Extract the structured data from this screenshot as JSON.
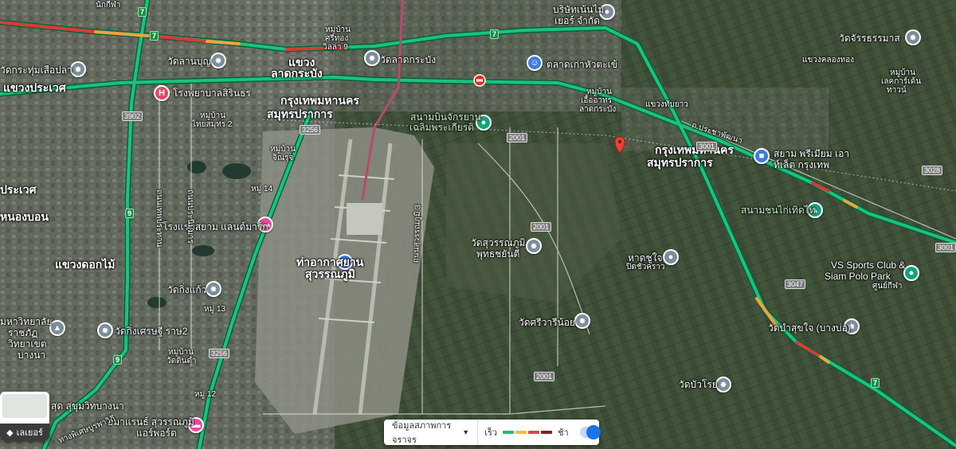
{
  "legend": {
    "traffic_label": "ข้อมูลสภาพการจราจร",
    "fast_label": "เร็ว",
    "slow_label": "ช้า",
    "scale_colors": [
      "#19c37d",
      "#f2c12e",
      "#e3463b",
      "#8c1d1d"
    ],
    "toggle_on": true
  },
  "layers_button": {
    "label": "เลเยอร์"
  },
  "colors": {
    "traffic_green": "#19c37d",
    "traffic_orange": "#f2a23a",
    "traffic_red": "#d83b32",
    "pin_red": "#ea4335"
  },
  "places": {
    "p1": "บริษัทเน้นไม",
    "p1b": "เยอร์ จำกัด",
    "p2": "วัดจัรรธรรมาส",
    "p3": "วัดลานบุญ",
    "p4": "แขวง",
    "p4b": "ลาดกระบัง",
    "p5": "วัดลาดกระบัง",
    "p6": "ตลาดเก่าหัวตะเข้",
    "p7": "วัดกระทุ่มเสือปลา",
    "p8": "แขวงประเวศ",
    "p9": "โรงพยาบาลสิรินธร",
    "p10": "กรุงเทพมหานคร",
    "p10b": "สมุทรปราการ",
    "p11": "สนามบินจักรยาน",
    "p11b": "เฉลิมพระเกียรติ",
    "p12": "กรุงเทพมหานคร",
    "p12b": "สมุทรปราการ",
    "p13": "สยาม พรีเมียม เอา",
    "p13b": "ท์เล็ต กรุงเทพ",
    "p14": "สนามชนไก่เทิดไท",
    "p15": "ประเวศ",
    "p16": "หนองบอน",
    "p17": "โรงแรมสยาม แลนด์มาร์ก",
    "p18": "ท่าอากาศยาน",
    "p18b": "สุวรรณภูมิ",
    "p19": "วัดสุวรรณภูมิ",
    "p19b": "พุทธชยันตี",
    "p20": "หาดชูใจ",
    "p20b": "ปิดชั่วคราว",
    "p21": "VS Sports Club &",
    "p21b": "Siam Polo Park",
    "p21c": "ศูนย์กีฬา",
    "p22": "แขวงดอกไม้",
    "p23": "วัดกิ่งแก้ว",
    "p24": "มหาวิทยาลัย",
    "p24b": "ราชภัฏ",
    "p24c": "วิทยาเขต",
    "p24d": "บางนา",
    "p25": "วัดกิ่งเศรษฐี ราษ2",
    "p26": "วัดศรีวารีน้อย",
    "p27": "วัดบำสุขใจ (บางบ่อ)",
    "p28": "วัดบัวโรย",
    "p29": "อมาแรนธ์ สุวรรณภูมิ",
    "p29b": "แอร์พอร์ต",
    "p30": "สุด สุขุมวิทบางนา",
    "p31": "ทางพิเศษบูรพาวิถี"
  },
  "small_labels": {
    "s1": "นักกีฬา",
    "s2": "หมู่บ้าน",
    "s2b": "ศรีทอง",
    "s2c": "วิลล่า 9",
    "s3": "หมู่บ้าน",
    "s3b": "ไทยสมุทร 2",
    "s4": "หมู่บ้าน",
    "s4b": "จิณรุจ",
    "s5": "หมู่ 14",
    "s6": "หมู่บ้าน",
    "s6b": "เอื้ออาทร",
    "s6c": "ลาดกระบัง",
    "s7": "แขวงทับยาว",
    "s8": "ถ.ประชาพัฒนา",
    "s9": "แขวงคลองทอง",
    "s10": "หมู่บ้าน",
    "s10b": "เลคการ์เด้น",
    "s10c": "ทาวน์",
    "s11": "หมู่ 13",
    "s12": "หมู่บ้าน",
    "s12b": "วัดดินดำ",
    "s13": "หมู่ 12",
    "s14": "ถนนสุวรรณภูมิ 3",
    "s15": "สุขุมวิท"
  },
  "vertical_labels": {
    "v1": "ถนนเทพประทาน",
    "v2": "ถนนประนิมมาร"
  },
  "shields": {
    "a": "7",
    "b": "7",
    "c": "9",
    "d": "9",
    "e": "7",
    "f": "7",
    "g": "3902",
    "h": "3256",
    "i": "2001",
    "j": "2001",
    "k": "2001",
    "l": "3001",
    "m": "3028",
    "n": "3001",
    "o": "3047",
    "p": "3256",
    "q": "7"
  }
}
